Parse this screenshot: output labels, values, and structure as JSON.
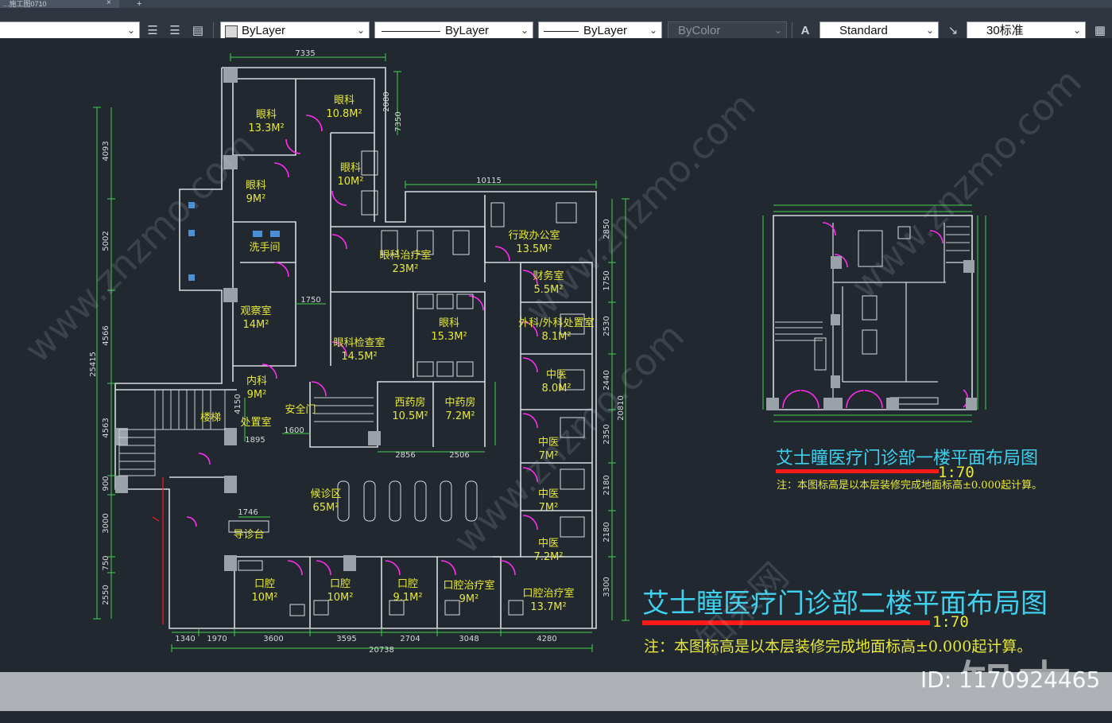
{
  "window": {
    "tab_title": "...施工图0710",
    "tab_close": "×",
    "tab_add": "+"
  },
  "toolbar": {
    "color_value": "ByLayer",
    "linetype_value": "ByLayer",
    "lineweight_value": "ByLayer",
    "plotstyle_value": "ByColor",
    "textstyle_value": "Standard",
    "dimstyle_value": "30标准"
  },
  "drawing": {
    "floor1": {
      "title": "艾士瞳医疗门诊部一楼平面布局图",
      "scale": "1:70",
      "note": "注：本图标高是以本层装修完成地面标高±0.000起计算。"
    },
    "floor2": {
      "title": "艾士瞳医疗门诊部二楼平面布局图",
      "scale": "1:70",
      "note": "注：本图标高是以本层装修完成地面标高±0.000起计算。",
      "rooms": [
        {
          "name": "眼科",
          "area": "13.3M²"
        },
        {
          "name": "眼科",
          "area": "10.8M²"
        },
        {
          "name": "眼科",
          "area": "10M²"
        },
        {
          "name": "眼科",
          "area": "9M²"
        },
        {
          "name": "洗手间",
          "area": ""
        },
        {
          "name": "观察室",
          "area": "14M²"
        },
        {
          "name": "眼科治疗室",
          "area": "23M²"
        },
        {
          "name": "行政办公室",
          "area": "13.5M²"
        },
        {
          "name": "财务室",
          "area": "5.5M²"
        },
        {
          "name": "外科/外科处置室",
          "area": "8.1M²"
        },
        {
          "name": "眼科检查室",
          "area": "14.5M²"
        },
        {
          "name": "眼科",
          "area": "15.3M²"
        },
        {
          "name": "内科",
          "area": "9M²"
        },
        {
          "name": "处置室",
          "area": ""
        },
        {
          "name": "安全门",
          "area": ""
        },
        {
          "name": "西药房",
          "area": "10.5M²"
        },
        {
          "name": "中药房",
          "area": "7.2M²"
        },
        {
          "name": "中医",
          "area": "8.0M²"
        },
        {
          "name": "中医",
          "area": "7M²"
        },
        {
          "name": "中医",
          "area": "7M²"
        },
        {
          "name": "中医",
          "area": "7.2M²"
        },
        {
          "name": "楼梯",
          "area": ""
        },
        {
          "name": "候诊区",
          "area": "65M²"
        },
        {
          "name": "导诊台",
          "area": ""
        },
        {
          "name": "口腔",
          "area": "10M²"
        },
        {
          "name": "口腔",
          "area": "10M²"
        },
        {
          "name": "口腔",
          "area": "9.1M²"
        },
        {
          "name": "口腔治疗室",
          "area": "9M²"
        },
        {
          "name": "口腔治疗室",
          "area": "13.7M²"
        }
      ],
      "dimensions": {
        "top": "7335",
        "top_right": "10115",
        "left_total": "25415",
        "left": [
          "4093",
          "5002",
          "4566",
          "4563",
          "900",
          "3000",
          "750",
          "2550"
        ],
        "right_total": "20810",
        "right": [
          "2850",
          "1750",
          "2530",
          "2440",
          "2350",
          "2180",
          "2180",
          "3300"
        ],
        "bottom_total": "20738",
        "bottom": [
          "1340",
          "1970",
          "3600",
          "3595",
          "2704",
          "3048",
          "4280"
        ],
        "misc": [
          "2080",
          "7350",
          "1750",
          "1600",
          "1895",
          "4150",
          "2856",
          "2506",
          "1746"
        ]
      }
    },
    "watermark": {
      "logo": "知末",
      "id": "ID: 1170924465",
      "site": "www.znzmo.com",
      "cn": "知末网"
    }
  }
}
